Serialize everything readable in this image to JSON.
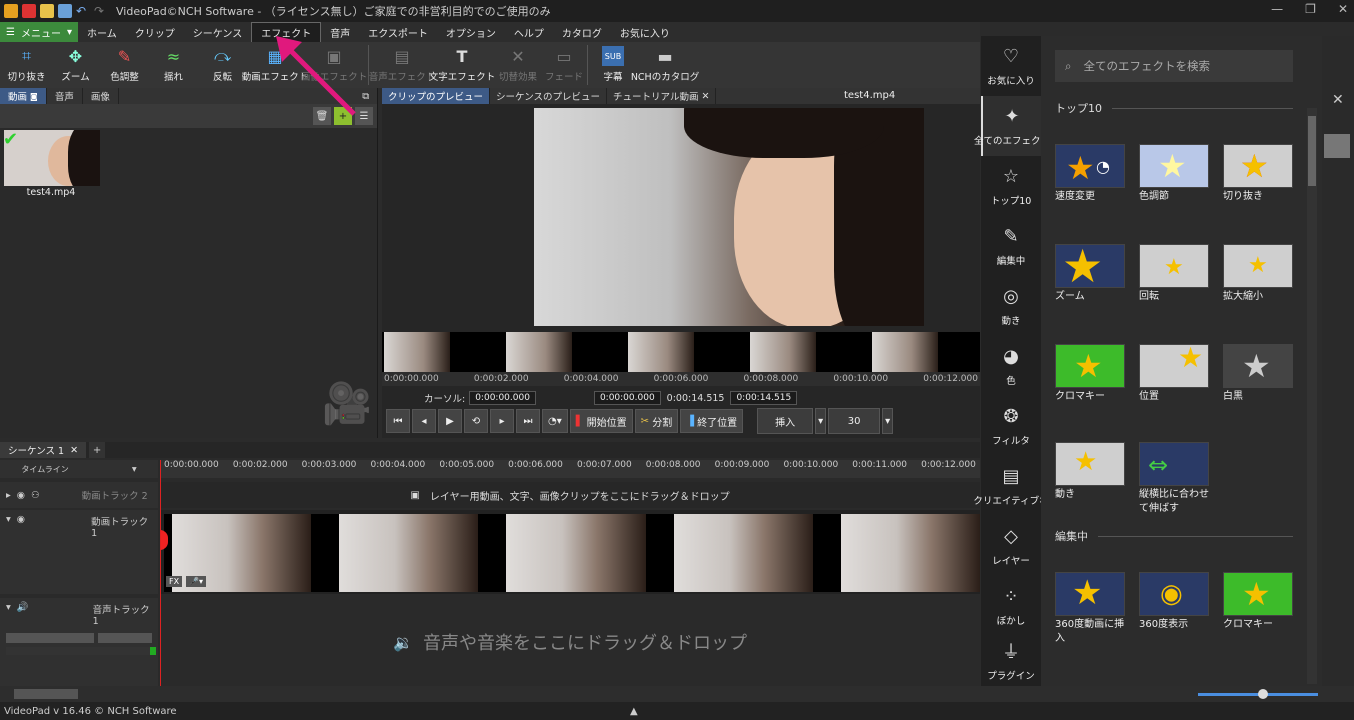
{
  "title": "VideoPad©NCH Software - （ライセンス無し）ご家庭での非営利目的でのご使用のみ",
  "menu_label": "メニュー",
  "menu": [
    "ホーム",
    "クリップ",
    "シーケンス",
    "エフェクト",
    "音声",
    "エクスポート",
    "オプション",
    "ヘルプ",
    "カタログ",
    "お気に入り"
  ],
  "toolbar": [
    "切り抜き",
    "ズーム",
    "色調整",
    "揺れ",
    "反転",
    "動画エフェクト",
    "画像エフェクト",
    "音声エフェクト",
    "文字エフェクト",
    "切替効果",
    "フェード",
    "字幕",
    "NCHのカタログ"
  ],
  "left_tabs": [
    "動画",
    "音声",
    "画像"
  ],
  "clip_name": "test4.mp4",
  "preview_tabs": [
    "クリップのプレビュー",
    "シーケンスのプレビュー",
    "チュートリアル動画"
  ],
  "preview_file": "test4.mp4",
  "preview_ruler": [
    "0:00:00.000",
    "0:00:02.000",
    "0:00:04.000",
    "0:00:06.000",
    "0:00:08.000",
    "0:00:10.000",
    "0:00:12.000"
  ],
  "cursor_label": "カーソル:",
  "cursor_time": "0:00:00.000",
  "range_start": "0:00:00.000",
  "range_end": "0:00:14.515",
  "duration": "0:00:14.515",
  "btn_start": "開始位置",
  "btn_split": "分割",
  "btn_end": "終了位置",
  "btn_insert": "挿入",
  "fps": "30",
  "seq_tab": "シーケンス 1",
  "timeline_label": "タイムライン",
  "timeline_ruler": [
    "0:00:00.000",
    "0:00:02.000",
    "0:00:03.000",
    "0:00:04.000",
    "0:00:05.000",
    "0:00:06.000",
    "0:00:07.000",
    "0:00:08.000",
    "0:00:09.000",
    "0:00:10.000",
    "0:00:11.000",
    "0:00:12.000"
  ],
  "track_video2": "動画トラック 2",
  "track_video1": "動画トラック 1",
  "track_audio1": "音声トラック 1",
  "overlay_hint": "レイヤー用動画、文字、画像クリップをここにドラッグ＆ドロップ",
  "audio_hint": "音声や音楽をここにドラッグ＆ドロップ",
  "status": "VideoPad v 16.46 © NCH Software",
  "fx_nav": [
    {
      "label": "お気に入り",
      "icon": "heart-icon",
      "glyph": "♡"
    },
    {
      "label": "全てのエフェクト",
      "icon": "magic-wand-icon",
      "glyph": "✦"
    },
    {
      "label": "トップ10",
      "icon": "star-icon",
      "glyph": "☆"
    },
    {
      "label": "編集中",
      "icon": "pencil-icon",
      "glyph": "✎"
    },
    {
      "label": "動き",
      "icon": "motion-icon",
      "glyph": "◎"
    },
    {
      "label": "色",
      "icon": "palette-icon",
      "glyph": "◕"
    },
    {
      "label": "フィルタ",
      "icon": "filter-icon",
      "glyph": "❂"
    },
    {
      "label": "クリエイティブな",
      "icon": "brush-icon",
      "glyph": "▤"
    },
    {
      "label": "レイヤー",
      "icon": "layers-icon",
      "glyph": "◇"
    },
    {
      "label": "ぼかし",
      "icon": "blur-icon",
      "glyph": "⁘"
    },
    {
      "label": "プラグイン",
      "icon": "plugin-icon",
      "glyph": "⏚"
    }
  ],
  "fx_search_placeholder": "全てのエフェクトを検索",
  "fx_sections": [
    "トップ10",
    "編集中"
  ],
  "fx_top10": [
    "速度変更",
    "色調節",
    "切り抜き",
    "ズーム",
    "回転",
    "拡大縮小",
    "クロマキー",
    "位置",
    "白黒",
    "動き",
    "縦横比に合わせて伸ばす"
  ],
  "fx_editing": [
    "360度動画に挿入",
    "360度表示",
    "クロマキー"
  ],
  "colors": {
    "accent": "#3d5a86",
    "menu_green": "#3c8a3c",
    "arrow": "#e0197d",
    "star": "#f5c000",
    "chroma": "#3dbb2a"
  }
}
